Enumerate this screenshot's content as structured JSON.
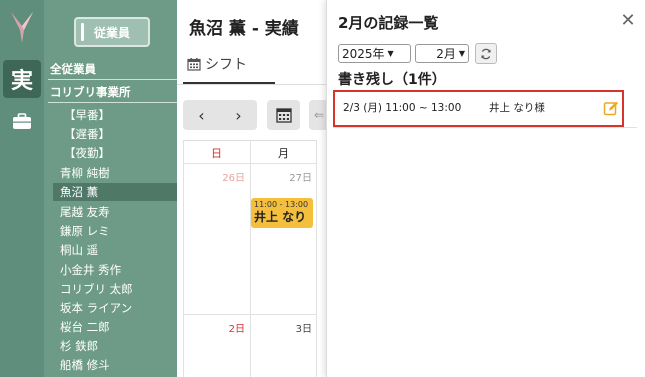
{
  "rail": {
    "active_label": "実"
  },
  "sidebar": {
    "employee_button": "従業員",
    "all_employees": "全従業員",
    "office": "コリブリ事業所",
    "shift_groups": [
      "【早番】",
      "【遅番】",
      "【夜勤】"
    ],
    "employees": [
      "青柳 純樹",
      "魚沼 薫",
      "尾越 友寿",
      "鎌原 レミ",
      "桐山 遥",
      "小金井 秀作",
      "コリブリ 太郎",
      "坂本 ライアン",
      "桜台 二郎",
      "杉 鉄郎",
      "船橋 修斗"
    ],
    "selected_employee": "魚沼 薫"
  },
  "main": {
    "title": "魚沼 薫 - 実績",
    "tab_label": "シフト",
    "prev": "‹",
    "next": "›",
    "calendar": {
      "weekday_headers": [
        "日",
        "月"
      ],
      "week1_days": [
        "26日",
        "27日"
      ],
      "week2_days": [
        "2日",
        "3日"
      ],
      "event": {
        "time": "11:00 - 13:00",
        "name": "井上 なり"
      }
    }
  },
  "records_panel": {
    "title": "2月の記録一覧",
    "year_select": "2025年",
    "month_select": "2月",
    "section_heading": "書き残し（1件）",
    "records": [
      {
        "datetime": "2/3 (月) 11:00 ~ 13:00",
        "person": "井上 なり様"
      }
    ]
  },
  "colors": {
    "rail": "#5f8f7c",
    "sidebar": "#6e9b87",
    "event": "#f4bf3c",
    "highlight_border": "#d9342b",
    "edit_icon": "#f0a81e"
  }
}
